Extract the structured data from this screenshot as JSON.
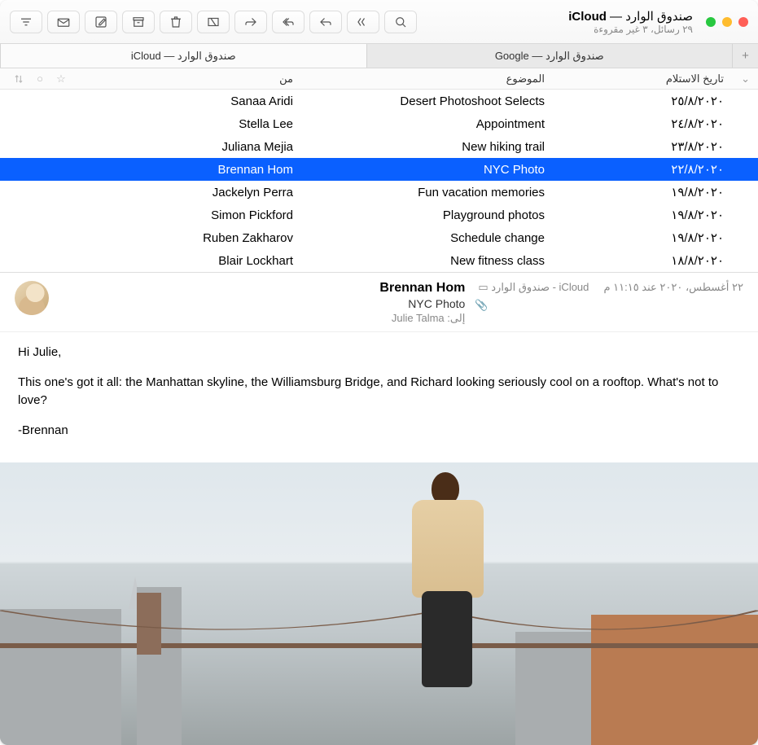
{
  "window": {
    "title_prefix": "صندوق الوارد",
    "title_sep": " — ",
    "title_account": "iCloud",
    "subtitle": "٢٩ رسائل، ٣ غير مقروءة"
  },
  "tabs": [
    {
      "label": "صندوق الوارد — iCloud",
      "active": true
    },
    {
      "label": "صندوق الوارد — Google",
      "active": false
    }
  ],
  "columns": {
    "from": "من",
    "subject": "الموضوع",
    "date": "تاريخ الاستلام"
  },
  "rows": [
    {
      "from": "Sanaa Aridi",
      "subject": "Desert Photoshoot Selects",
      "date": "٢٥/٨/٢٠٢٠",
      "selected": false
    },
    {
      "from": "Stella Lee",
      "subject": "Appointment",
      "date": "٢٤/٨/٢٠٢٠",
      "selected": false
    },
    {
      "from": "Juliana Mejia",
      "subject": "New hiking trail",
      "date": "٢٣/٨/٢٠٢٠",
      "selected": false
    },
    {
      "from": "Brennan Hom",
      "subject": "NYC Photo",
      "date": "٢٢/٨/٢٠٢٠",
      "selected": true
    },
    {
      "from": "Jackelyn Perra",
      "subject": "Fun vacation memories",
      "date": "١٩/٨/٢٠٢٠",
      "selected": false
    },
    {
      "from": "Simon Pickford",
      "subject": "Playground photos",
      "date": "١٩/٨/٢٠٢٠",
      "selected": false
    },
    {
      "from": "Ruben Zakharov",
      "subject": "Schedule change",
      "date": "١٩/٨/٢٠٢٠",
      "selected": false
    },
    {
      "from": "Blair Lockhart",
      "subject": "New fitness class",
      "date": "١٨/٨/٢٠٢٠",
      "selected": false
    }
  ],
  "message": {
    "sender": "Brennan Hom",
    "subject": "NYC Photo",
    "to_label": "إلى:",
    "to": "Julie Talma",
    "mailbox": "صندوق الوارد - iCloud",
    "timestamp": "٢٢ أغسطس، ٢٠٢٠ عند ١١:١٥ م",
    "body": [
      "Hi Julie,",
      "This one's got it all: the Manhattan skyline, the Williamsburg Bridge, and Richard looking seriously cool on a rooftop. What's not to love?",
      "-Brennan"
    ]
  }
}
